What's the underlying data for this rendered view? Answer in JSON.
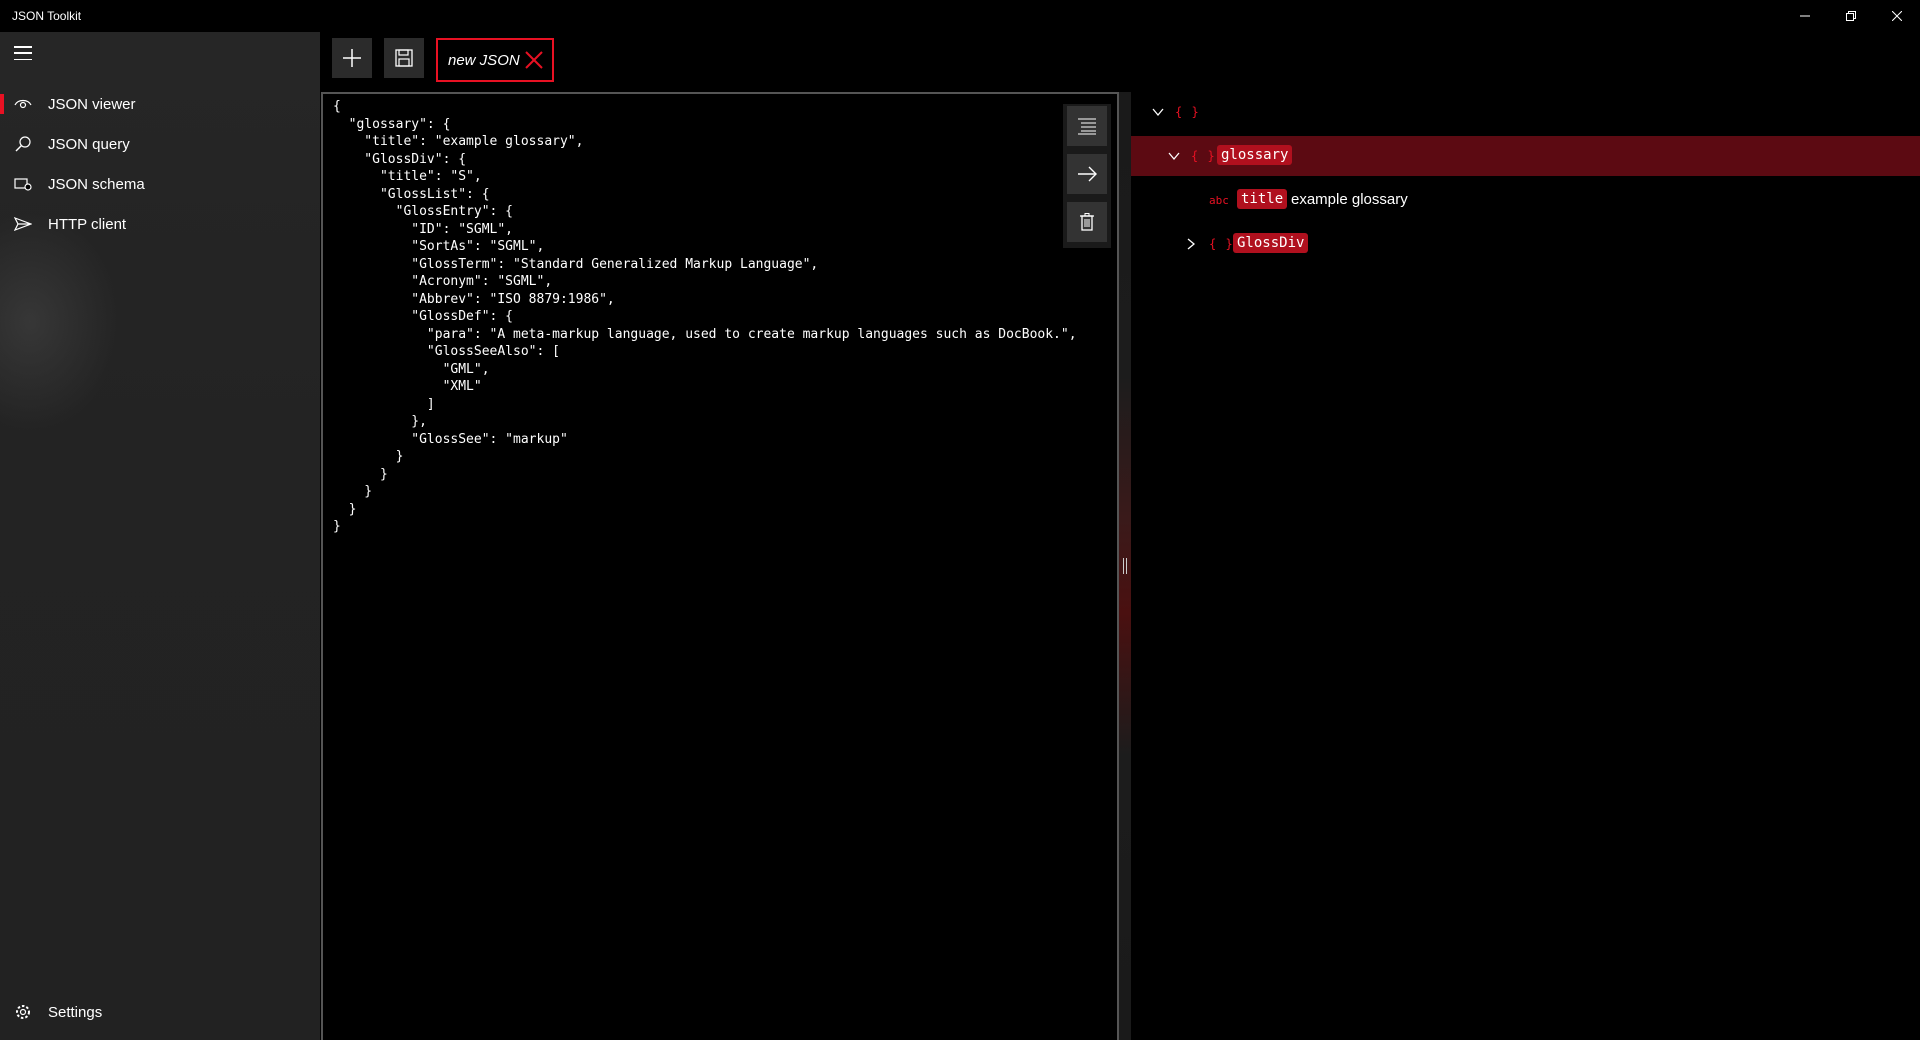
{
  "app": {
    "title": "JSON Toolkit"
  },
  "window_controls": {
    "minimize": "minimize-icon",
    "restore": "restore-icon",
    "close": "close-icon"
  },
  "sidebar": {
    "menu_icon": "hamburger-icon",
    "items": [
      {
        "label": "JSON viewer",
        "icon": "eye-icon",
        "selected": true
      },
      {
        "label": "JSON query",
        "icon": "search-icon",
        "selected": false
      },
      {
        "label": "JSON schema",
        "icon": "schema-icon",
        "selected": false
      },
      {
        "label": "HTTP client",
        "icon": "send-icon",
        "selected": false
      }
    ],
    "settings_label": "Settings"
  },
  "toolbar": {
    "add_icon": "plus-icon",
    "save_icon": "save-icon",
    "tab_label": "new JSON",
    "tab_close_icon": "close-icon"
  },
  "editor": {
    "content": "{\n  \"glossary\": {\n    \"title\": \"example glossary\",\n    \"GlossDiv\": {\n      \"title\": \"S\",\n      \"GlossList\": {\n        \"GlossEntry\": {\n          \"ID\": \"SGML\",\n          \"SortAs\": \"SGML\",\n          \"GlossTerm\": \"Standard Generalized Markup Language\",\n          \"Acronym\": \"SGML\",\n          \"Abbrev\": \"ISO 8879:1986\",\n          \"GlossDef\": {\n            \"para\": \"A meta-markup language, used to create markup languages such as DocBook.\",\n            \"GlossSeeAlso\": [\n              \"GML\",\n              \"XML\"\n            ]\n          },\n          \"GlossSee\": \"markup\"\n        }\n      }\n    }\n  }\n}",
    "actions": [
      "format-icon",
      "arrow-right-icon",
      "trash-icon"
    ]
  },
  "tree": {
    "root_brace": "{ }",
    "rows": [
      {
        "brace": "{ }",
        "key": "glossary",
        "expanded": true,
        "selected": true
      },
      {
        "type": "abc",
        "key": "title",
        "value": "example glossary"
      },
      {
        "brace": "{ }",
        "key": "GlossDiv",
        "expanded": false
      }
    ]
  },
  "colors": {
    "accent": "#e81123",
    "badge": "#b0101e",
    "selected_row": "#5c0a12",
    "sidebar_bg": "#262626"
  }
}
